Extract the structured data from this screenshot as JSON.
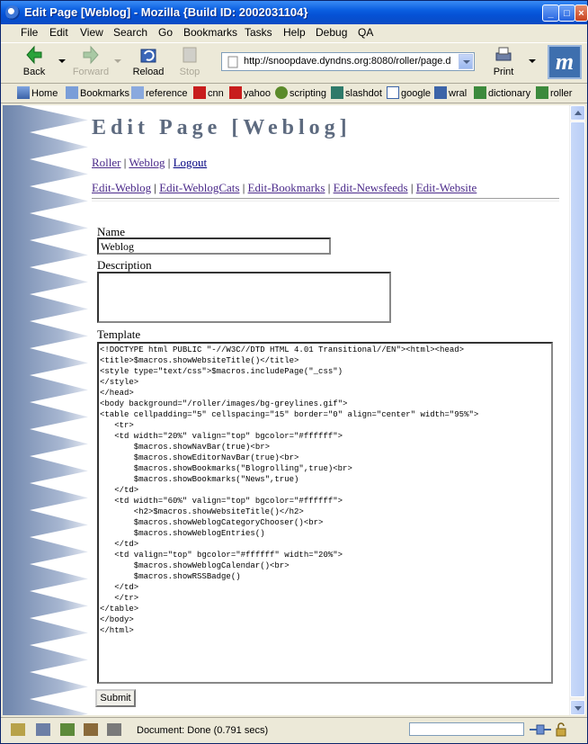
{
  "window": {
    "title": "Edit Page [Weblog] - Mozilla {Build ID: 2002031104}"
  },
  "menu": [
    "File",
    "Edit",
    "View",
    "Search",
    "Go",
    "Bookmarks",
    "Tasks",
    "Help",
    "Debug",
    "QA"
  ],
  "toolbar": {
    "back": "Back",
    "forward": "Forward",
    "reload": "Reload",
    "stop": "Stop",
    "print": "Print",
    "url": "http://snoopdave.dyndns.org:8080/roller/page.d"
  },
  "personal_bar": [
    "Home",
    "Bookmarks",
    "reference",
    "cnn",
    "yahoo",
    "scripting",
    "slashdot",
    "google",
    "wral",
    "dictionary",
    "roller"
  ],
  "page": {
    "title": "Edit Page [Weblog]",
    "nav": {
      "roller": "Roller",
      "weblog": "Weblog",
      "logout": "Logout",
      "sep": "|"
    },
    "subnav": [
      "Edit-Weblog",
      "Edit-WeblogCats",
      "Edit-Bookmarks",
      "Edit-Newsfeeds",
      "Edit-Website"
    ],
    "form": {
      "name_label": "Name",
      "name_value": "Weblog",
      "description_label": "Description",
      "description_value": "",
      "template_label": "Template",
      "template_value": "<!DOCTYPE html PUBLIC \"-//W3C//DTD HTML 4.01 Transitional//EN\"><html><head>\n<title>$macros.showWebsiteTitle()</title>\n<style type=\"text/css\">$macros.includePage(\"_css\")\n</style>\n</head>\n<body background=\"/roller/images/bg-greylines.gif\">\n<table cellpadding=\"5\" cellspacing=\"15\" border=\"0\" align=\"center\" width=\"95%\">\n   <tr>\n   <td width=\"20%\" valign=\"top\" bgcolor=\"#ffffff\">\n       $macros.showNavBar(true)<br>\n       $macros.showEditorNavBar(true)<br>\n       $macros.showBookmarks(\"Blogrolling\",true)<br>\n       $macros.showBookmarks(\"News\",true)\n   </td>\n   <td width=\"60%\" valign=\"top\" bgcolor=\"#ffffff\">\n       <h2>$macros.showWebsiteTitle()</h2>\n       $macros.showWeblogCategoryChooser()<br>\n       $macros.showWeblogEntries()\n   </td>\n   <td valign=\"top\" bgcolor=\"#ffffff\" width=\"20%\">\n       $macros.showWeblogCalendar()<br>\n       $macros.showRSSBadge()\n   </td>\n   </tr>\n</table>\n</body>\n</html>",
      "submit_label": "Submit"
    }
  },
  "status": {
    "text": "Document: Done (0.791 secs)"
  },
  "colors": {
    "titlebar": "#0a5ee0",
    "title_text": "#5d6a7f",
    "link": "#4b2a8a",
    "spike": "#7f95b8"
  }
}
